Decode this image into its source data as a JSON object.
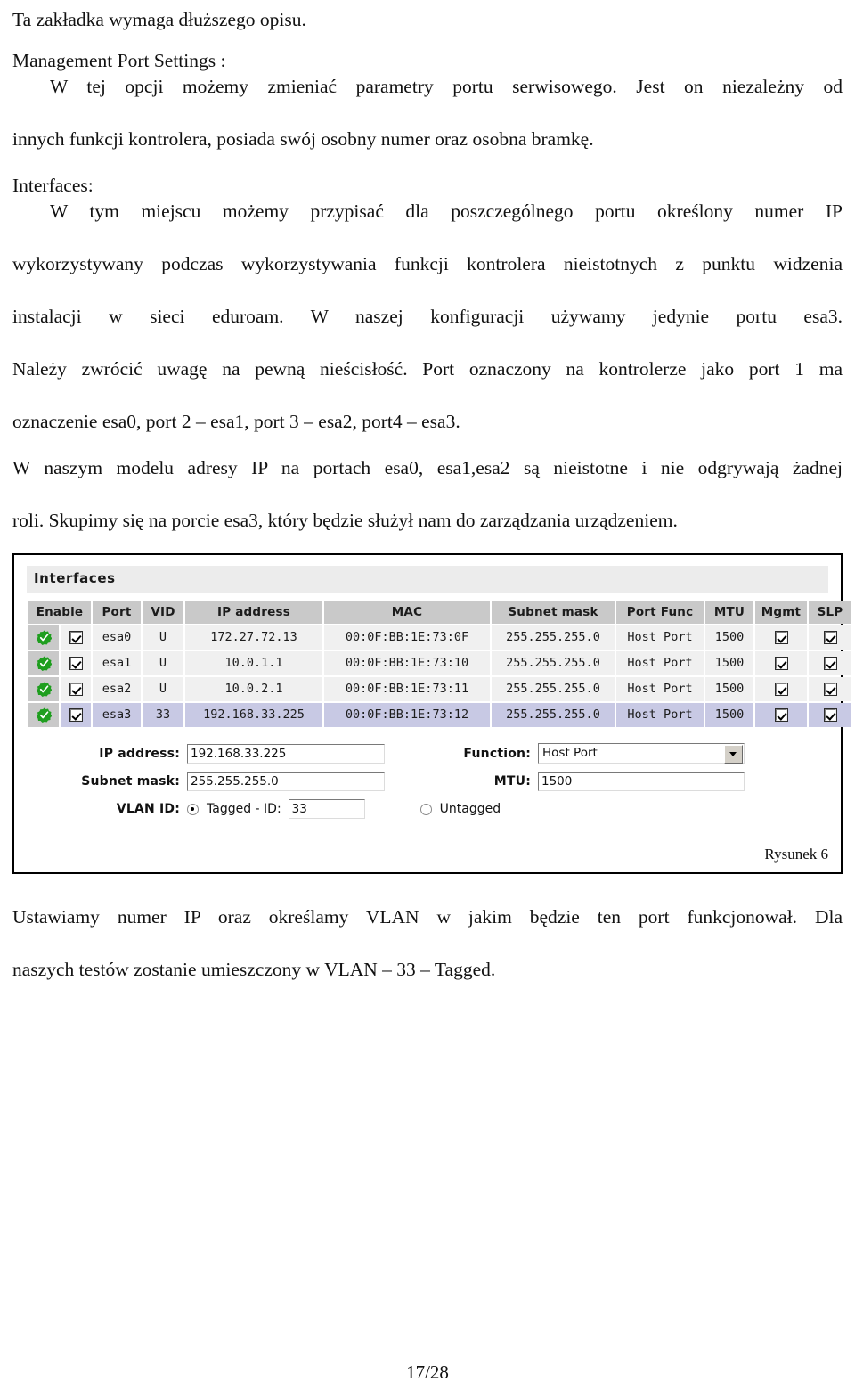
{
  "document": {
    "intro_line": "Ta zakładka wymaga dłuższego opisu.",
    "section1_heading": "Management Port Settings :",
    "section1_body_lines": [
      "W tej opcji możemy zmieniać parametry portu serwisowego. Jest on niezależny od",
      "innych funkcji kontrolera, posiada swój osobny numer oraz osobna bramkę."
    ],
    "section2_heading": "Interfaces:",
    "section2_body_lines": [
      "W tym miejscu możemy przypisać dla poszczególnego portu określony numer IP",
      "wykorzystywany podczas wykorzystywania funkcji kontrolera nieistotnych z punktu widzenia",
      "instalacji w sieci eduroam. W naszej konfiguracji używamy jedynie portu esa3.",
      "Należy zwrócić uwagę na pewną nieścisłość. Port oznaczony na kontrolerze jako port 1 ma",
      "oznaczenie esa0, port 2 – esa1, port 3 – esa2, port4 – esa3."
    ],
    "section3_body_lines": [
      "W naszym modelu adresy IP na portach esa0, esa1,esa2 są nieistotne i nie odgrywają żadnej",
      "roli. Skupimy się na porcie esa3, który będzie służył nam do zarządzania urządzeniem."
    ],
    "closing_body_lines": [
      "Ustawiamy numer IP oraz określamy VLAN w jakim będzie ten port funkcjonował. Dla",
      "naszych testów zostanie umieszczony w VLAN –  33  – Tagged."
    ],
    "figure_caption": "Rysunek 6",
    "page_number": "17/28"
  },
  "figure": {
    "panel_title": "Interfaces",
    "table": {
      "columns": [
        "Enable",
        "Port",
        "VID",
        "IP address",
        "MAC",
        "Subnet mask",
        "Port Func",
        "MTU",
        "Mgmt",
        "SLP"
      ],
      "rows": [
        {
          "status": "ok",
          "enable_checked": true,
          "port": "esa0",
          "vid": "U",
          "ip_address": "172.27.72.13",
          "mac": "00:0F:BB:1E:73:0F",
          "subnet_mask": "255.255.255.0",
          "port_func": "Host Port",
          "mtu": "1500",
          "mgmt_checked": true,
          "slp_checked": true,
          "selected": false
        },
        {
          "status": "ok",
          "enable_checked": true,
          "port": "esa1",
          "vid": "U",
          "ip_address": "10.0.1.1",
          "mac": "00:0F:BB:1E:73:10",
          "subnet_mask": "255.255.255.0",
          "port_func": "Host Port",
          "mtu": "1500",
          "mgmt_checked": true,
          "slp_checked": true,
          "selected": false
        },
        {
          "status": "ok",
          "enable_checked": true,
          "port": "esa2",
          "vid": "U",
          "ip_address": "10.0.2.1",
          "mac": "00:0F:BB:1E:73:11",
          "subnet_mask": "255.255.255.0",
          "port_func": "Host Port",
          "mtu": "1500",
          "mgmt_checked": true,
          "slp_checked": true,
          "selected": false
        },
        {
          "status": "ok",
          "enable_checked": true,
          "port": "esa3",
          "vid": "33",
          "ip_address": "192.168.33.225",
          "mac": "00:0F:BB:1E:73:12",
          "subnet_mask": "255.255.255.0",
          "port_func": "Host Port",
          "mtu": "1500",
          "mgmt_checked": true,
          "slp_checked": true,
          "selected": true
        }
      ]
    },
    "form": {
      "ip_address_label": "IP address:",
      "ip_address_value": "192.168.33.225",
      "subnet_mask_label": "Subnet mask:",
      "subnet_mask_value": "255.255.255.0",
      "vlan_id_label": "VLAN ID:",
      "tagged_label": "Tagged - ID:",
      "tagged_selected": true,
      "vlan_id_value": "33",
      "untagged_label": "Untagged",
      "untagged_selected": false,
      "function_label": "Function:",
      "function_value": "Host Port",
      "mtu_label": "MTU:",
      "mtu_value": "1500"
    },
    "colors": {
      "status_green": "#1f9e1f",
      "selected_row": "#c8c9e4",
      "header_gray": "#c9c9c9",
      "cell_gray": "#f0f0f0",
      "panel_title_bg": "#ececec"
    }
  }
}
